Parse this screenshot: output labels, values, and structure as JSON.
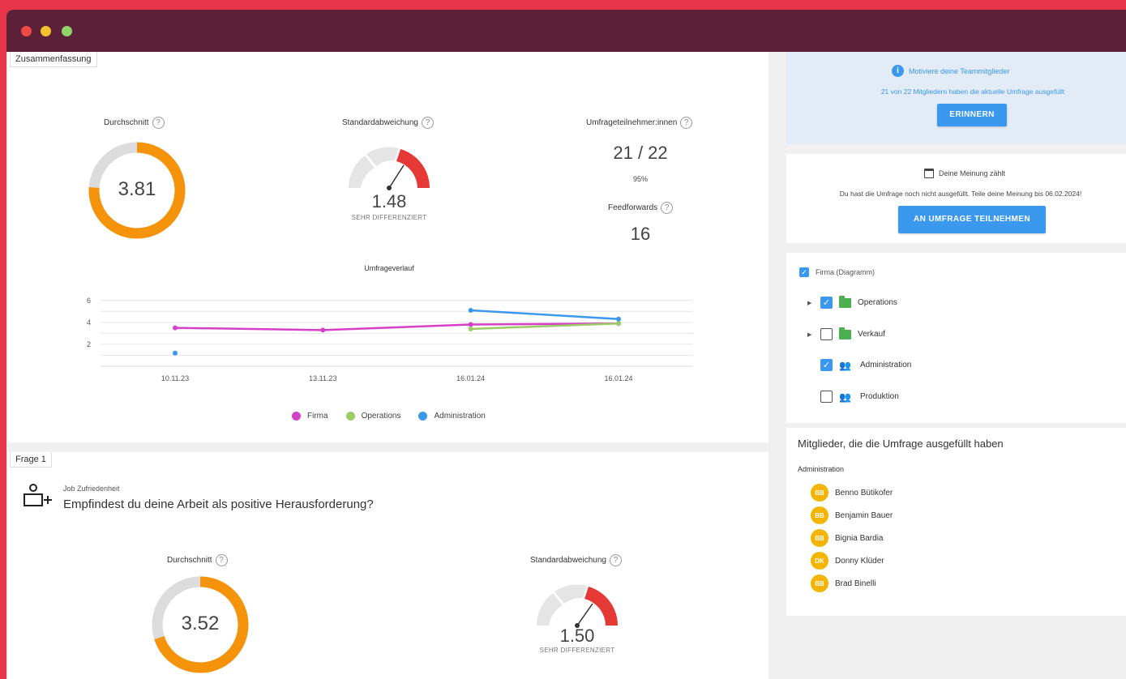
{
  "summary": {
    "tab": "Zusammenfassung",
    "avg_label": "Durchschnitt",
    "avg_value": "3.81",
    "avg_fraction": 0.76,
    "std_label": "Standardabweichung",
    "std_value": "1.48",
    "std_sub": "SEHR DIFFERENZIERT",
    "participants_label": "Umfrageteilnehmer:innen",
    "participants_value": "21 / 22",
    "participants_percent": "95%",
    "feedforwards_label": "Feedforwards",
    "feedforwards_value": "16"
  },
  "chart_data": {
    "type": "line",
    "title": "Umfrageverlauf",
    "categories": [
      "10.11.23",
      "13.11.23",
      "16.01.24",
      "16.01.24"
    ],
    "yticks": [
      2,
      4,
      6
    ],
    "ylim": [
      0,
      6.5
    ],
    "series": [
      {
        "name": "Firma",
        "color": "#d63fc8",
        "values": [
          3.5,
          3.3,
          3.8,
          3.9
        ]
      },
      {
        "name": "Operations",
        "color": "#9ccc65",
        "values": [
          null,
          null,
          3.4,
          3.9
        ]
      },
      {
        "name": "Administration",
        "color": "#3a98ee",
        "values": [
          1.2,
          null,
          5.1,
          4.3
        ]
      }
    ]
  },
  "question": {
    "tab": "Frage 1",
    "category": "Job Zufriedenheit",
    "text": "Empfindest du deine Arbeit als positive Herausforderung?",
    "avg_label": "Durchschnitt",
    "avg_value": "3.52",
    "avg_fraction": 0.7,
    "std_label": "Standardabweichung",
    "std_value": "1.50",
    "std_sub": "SEHR DIFFERENZIERT"
  },
  "reminder": {
    "title": "Motiviere deine Teammitglieder",
    "text": "21 von 22 Mitgliedern haben die aktuelle Umfrage ausgefüllt",
    "button": "ERINNERN"
  },
  "opinion": {
    "title": "Deine Meinung zählt",
    "text": "Du hast die Umfrage noch nicht ausgefüllt. Teile deine Meinung bis 06.02.2024!",
    "button": "AN UMFRAGE TEILNEHMEN"
  },
  "filter": {
    "root": "Firma (Diagramm)",
    "items": [
      {
        "label": "Operations"
      },
      {
        "label": "Verkauf"
      },
      {
        "label": "Administration"
      },
      {
        "label": "Produktion"
      }
    ]
  },
  "members": {
    "title": "Mitglieder, die die Umfrage ausgefüllt haben",
    "group": "Administration",
    "list": [
      {
        "initials": "BB",
        "name": "Benno Bütikofer"
      },
      {
        "initials": "BB",
        "name": "Benjamin Bauer"
      },
      {
        "initials": "BB",
        "name": "Bignia Bardia"
      },
      {
        "initials": "DK",
        "name": "Donny Klüder"
      },
      {
        "initials": "BB",
        "name": "Brad Binelli"
      }
    ]
  },
  "colors": {
    "accent": "#3a98ee",
    "orange": "#f5930a",
    "red": "#e53935",
    "titlebar": "#5c2138",
    "background": "#e8344a"
  }
}
